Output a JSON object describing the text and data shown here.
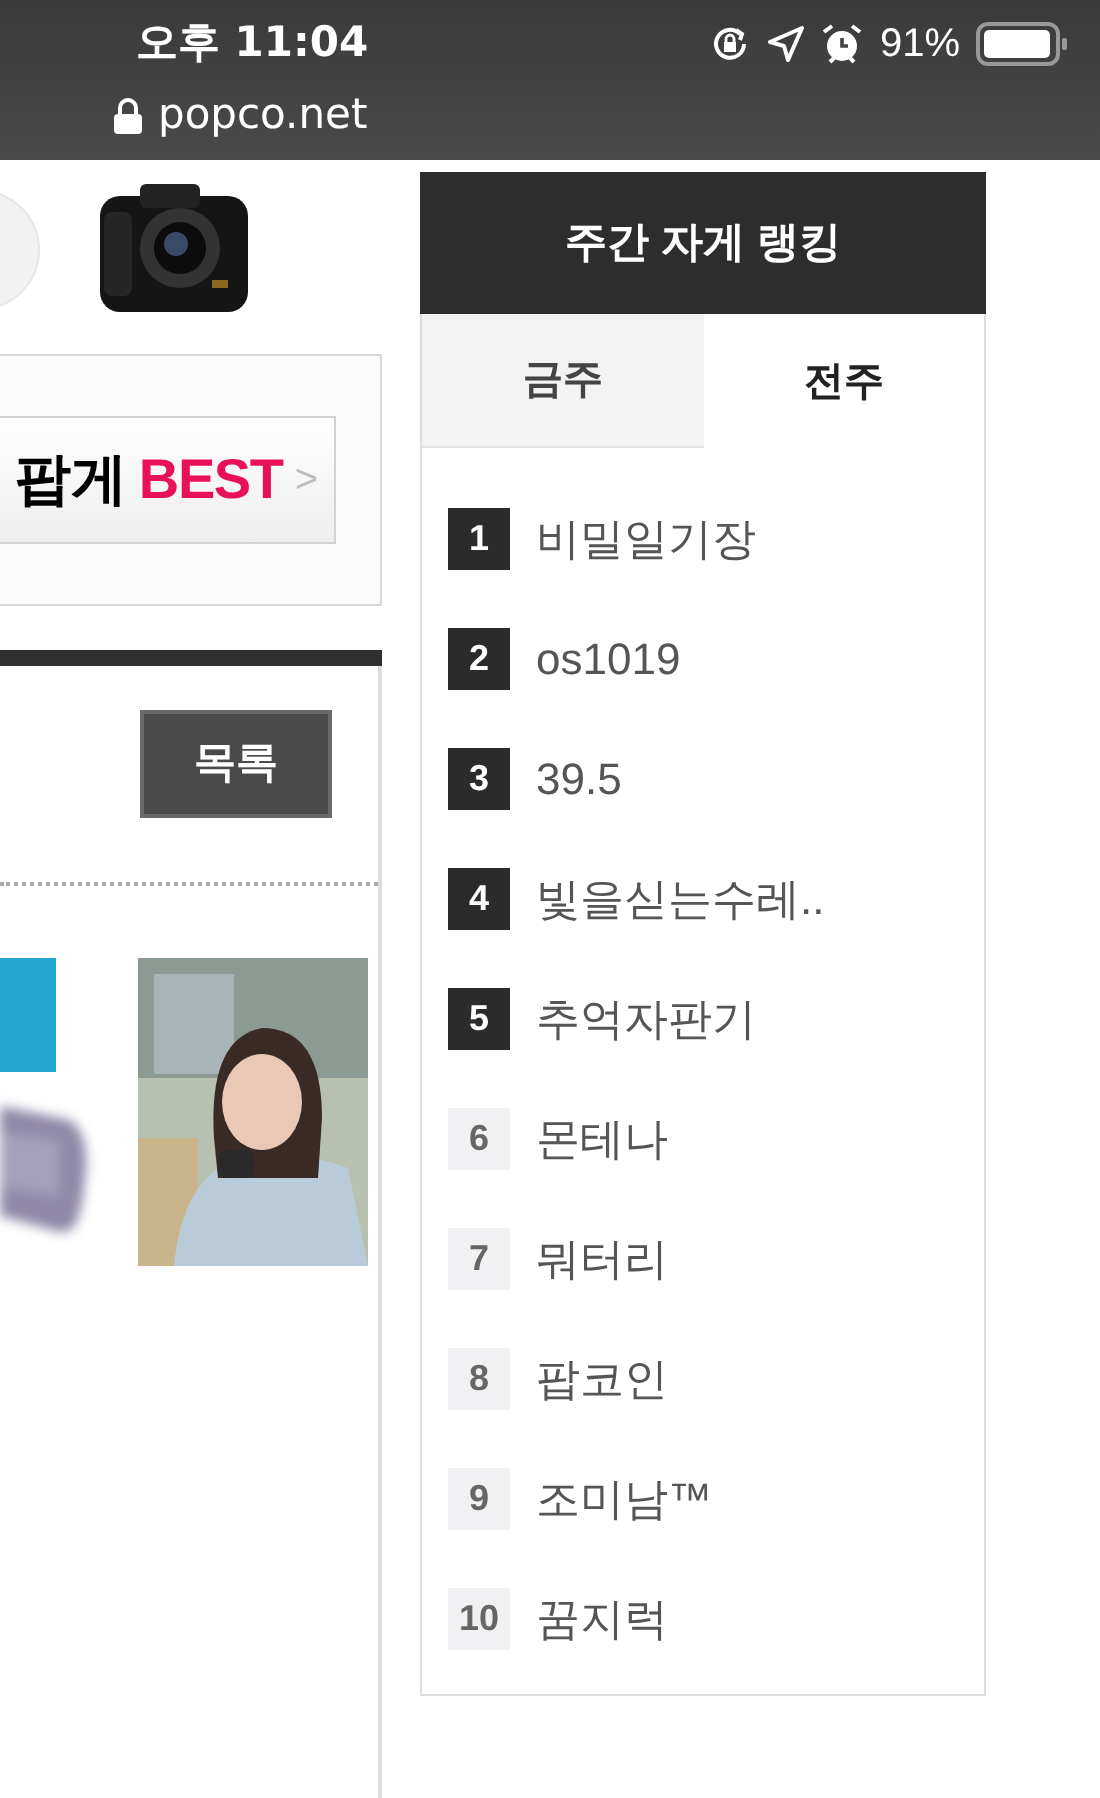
{
  "status_bar": {
    "time": "오후 11:04",
    "battery": "91%"
  },
  "address_bar": {
    "url": "popco.net"
  },
  "banner": {
    "label": "팝게",
    "highlight": "BEST",
    "arrow": ">"
  },
  "list_button": "목록",
  "ranking": {
    "title": "주간 자게 랭킹",
    "tabs": [
      {
        "label": "금주",
        "selected": false
      },
      {
        "label": "전주",
        "selected": true
      }
    ],
    "items": [
      {
        "rank": "1",
        "name": "비밀일기장",
        "top": true
      },
      {
        "rank": "2",
        "name": "os1019",
        "top": true
      },
      {
        "rank": "3",
        "name": "39.5",
        "top": true
      },
      {
        "rank": "4",
        "name": "빛을싣는수레..",
        "top": true
      },
      {
        "rank": "5",
        "name": "추억자판기",
        "top": true
      },
      {
        "rank": "6",
        "name": "몬테나",
        "top": false
      },
      {
        "rank": "7",
        "name": "뭐터리",
        "top": false
      },
      {
        "rank": "8",
        "name": "팝코인",
        "top": false
      },
      {
        "rank": "9",
        "name": "조미남™",
        "top": false
      },
      {
        "rank": "10",
        "name": "꿈지럭",
        "top": false
      }
    ]
  }
}
